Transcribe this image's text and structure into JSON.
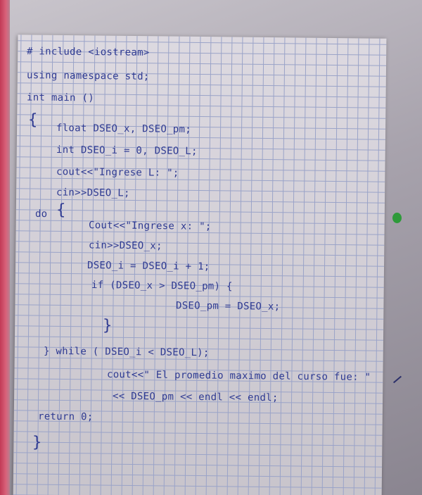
{
  "document": {
    "lines": [
      "# include <iostream>",
      "using namespace std;",
      "int main ()",
      "{",
      "float DSEO_x, DSEO_pm;",
      "int DSEO_i = 0, DSEO_L;",
      "cout<<\"Ingrese L: \";",
      "cin>>DSEO_L;",
      "do",
      "{",
      "Cout<<\"Ingrese x: \";",
      "cin>>DSEO_x;",
      "DSEO_i = DSEO_i + 1;",
      "if (DSEO_x > DSEO_pm) {",
      "DSEO_pm = DSEO_x;",
      "}",
      "} while ( DSEO_i < DSEO_L);",
      "cout<<\" El promedio maximo del curso fue: \"",
      "<< DSEO_pm << endl << endl;",
      "return 0;",
      "}"
    ]
  },
  "colors": {
    "ink": "#2e3a92",
    "grid": "#9aa3c8",
    "paper": "#d9d5dd",
    "binder_edge": "#c23a56",
    "marker_dot": "#2e9a3a"
  }
}
